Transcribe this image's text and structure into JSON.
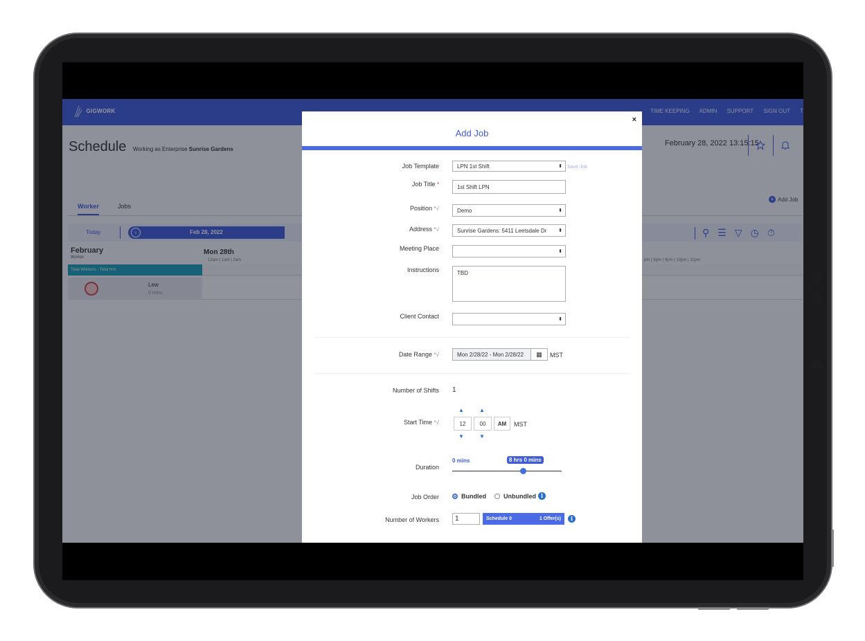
{
  "app": {
    "logo_text": "GIGWORK",
    "nav": [
      "TIME KEEPING",
      "ADMIN",
      "SUPPORT",
      "SIGN OUT",
      "T"
    ]
  },
  "header": {
    "title": "Schedule",
    "subtitle_prefix": "Working as Enterprise",
    "subtitle_bold": "Sunrise Gardens",
    "datetime": "February 28, 2022 13:15:15",
    "add_job": "Add Job"
  },
  "tabs": [
    {
      "label": "Worker",
      "active": true
    },
    {
      "label": "Jobs",
      "active": false
    }
  ],
  "datebar": {
    "today": "Today",
    "date": "Feb 28, 2022"
  },
  "grid": {
    "month": "February",
    "worker_label": "Worker",
    "day": "Mon 28th",
    "hours_left": "12am   |   1am   |   2am",
    "hours_right": "pm   |   8pm   |   9pm   |   10pm   |   11pm",
    "total_label": "Total Workers - Total Hrs",
    "workers": [
      {
        "name": "Lew",
        "mins": "0 mins"
      }
    ]
  },
  "modal": {
    "close": "×",
    "title": "Add Job",
    "job_template": {
      "label": "Job Template",
      "value": "LPN 1st Shift",
      "save": "Save Job"
    },
    "job_title": {
      "label": "Job Title",
      "req": "*",
      "value": "1st Shift  LPN"
    },
    "position": {
      "label": "Position",
      "req": "*√",
      "value": "Demo"
    },
    "address": {
      "label": "Address",
      "req": "*√",
      "value": "Sunrise Gardens: 5411 Leetsdale Dr"
    },
    "meeting_place": {
      "label": "Meeting Place",
      "value": ""
    },
    "instructions": {
      "label": "Instructions",
      "value": "TBD"
    },
    "client_contact": {
      "label": "Client Contact",
      "value": ""
    },
    "date_range": {
      "label": "Date Range",
      "req": "*√",
      "value": "Mon 2/28/22 - Mon 2/28/22",
      "tz": "MST"
    },
    "num_shifts": {
      "label": "Number of Shifts",
      "value": "1"
    },
    "start_time": {
      "label": "Start Time",
      "req": "*√",
      "hour": "12",
      "minute": "00",
      "ampm": "AM",
      "tz": "MST"
    },
    "duration": {
      "label": "Duration",
      "min": "0 mins",
      "max": "8 hrs 0 mins",
      "fraction": 0.65
    },
    "job_order": {
      "label": "Job Order",
      "options": [
        "Bundled",
        "Unbundled"
      ],
      "selected": "Bundled"
    },
    "num_workers": {
      "label": "Number of Workers",
      "value": "1",
      "schedule": "Schedule 0",
      "offers": "1 Offer(s)"
    }
  }
}
